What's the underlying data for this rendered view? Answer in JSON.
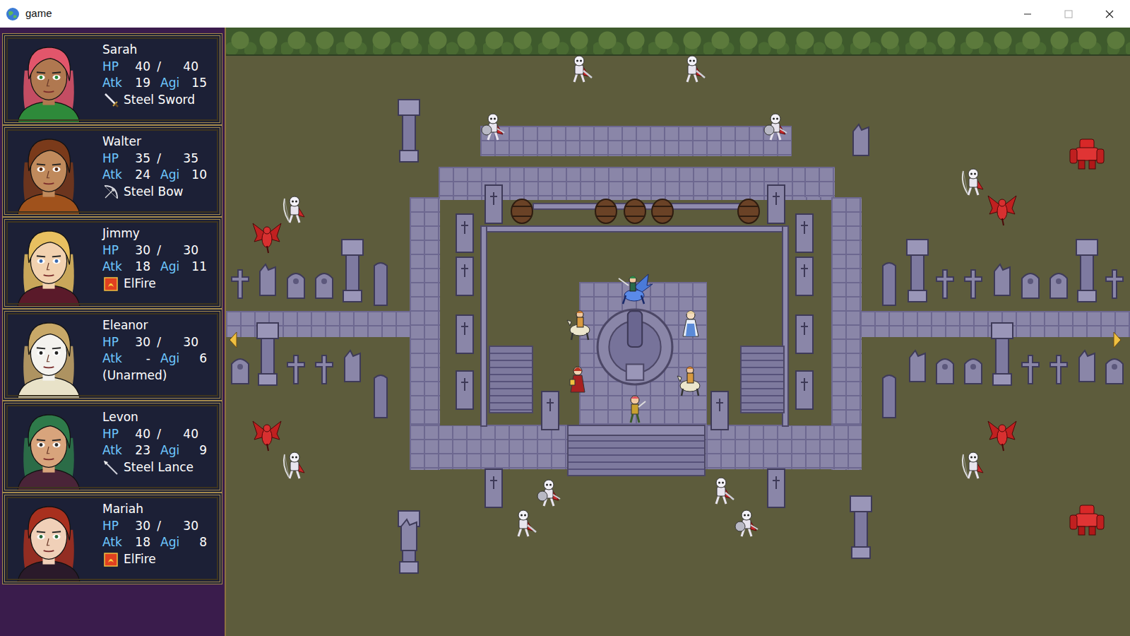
{
  "window": {
    "title": "game"
  },
  "party": [
    {
      "name": "Sarah",
      "hp_label": "HP",
      "hp": "40",
      "sep": "/",
      "max_hp": "40",
      "atk_label": "Atk",
      "atk": "19",
      "agi_label": "Agi",
      "agi": "15",
      "weapon": "Steel Sword",
      "kind": "sword",
      "color": "#e2566b"
    },
    {
      "name": "Walter",
      "hp_label": "HP",
      "hp": "35",
      "sep": "/",
      "max_hp": "35",
      "atk_label": "Atk",
      "atk": "24",
      "agi_label": "Agi",
      "agi": "10",
      "weapon": "Steel Bow",
      "kind": "bow",
      "color": "#7a3a1a"
    },
    {
      "name": "Jimmy",
      "hp_label": "HP",
      "hp": "30",
      "sep": "/",
      "max_hp": "30",
      "atk_label": "Atk",
      "atk": "18",
      "agi_label": "Agi",
      "agi": "11",
      "weapon": "ElFire",
      "kind": "tome",
      "color": "#e8c060"
    },
    {
      "name": "Eleanor",
      "hp_label": "HP",
      "hp": "30",
      "sep": "/",
      "max_hp": "30",
      "atk_label": "Atk",
      "atk": "-",
      "agi_label": "Agi",
      "agi": "6",
      "weapon": "(Unarmed)",
      "kind": "none",
      "color": "#c8a868"
    },
    {
      "name": "Levon",
      "hp_label": "HP",
      "hp": "40",
      "sep": "/",
      "max_hp": "40",
      "atk_label": "Atk",
      "atk": "23",
      "agi_label": "Agi",
      "agi": "9",
      "weapon": "Steel Lance",
      "kind": "lance",
      "color": "#2e7a4a"
    },
    {
      "name": "Mariah",
      "hp_label": "HP",
      "hp": "30",
      "sep": "/",
      "max_hp": "30",
      "atk_label": "Atk",
      "atk": "18",
      "agi_label": "Agi",
      "agi": "8",
      "weapon": "ElFire",
      "kind": "tome",
      "color": "#a8301e"
    }
  ],
  "map": {
    "units": [
      {
        "kind": "pegasus"
      },
      {
        "kind": "cavalier"
      },
      {
        "kind": "cleric"
      },
      {
        "kind": "mage"
      },
      {
        "kind": "cavalier"
      },
      {
        "kind": "fighter"
      },
      {
        "kind": "skeleton"
      },
      {
        "kind": "skeleton"
      },
      {
        "kind": "skeleton"
      },
      {
        "kind": "skeleton"
      },
      {
        "kind": "skeleton-shield"
      },
      {
        "kind": "skeleton-shield"
      },
      {
        "kind": "skeleton-shield"
      },
      {
        "kind": "skeleton-shield"
      },
      {
        "kind": "skeleton-archer"
      },
      {
        "kind": "skeleton-archer"
      },
      {
        "kind": "skeleton-archer"
      },
      {
        "kind": "skeleton-archer"
      },
      {
        "kind": "gargoyle"
      },
      {
        "kind": "gargoyle"
      },
      {
        "kind": "gargoyle"
      },
      {
        "kind": "gargoyle"
      },
      {
        "kind": "golem"
      },
      {
        "kind": "golem"
      }
    ]
  }
}
